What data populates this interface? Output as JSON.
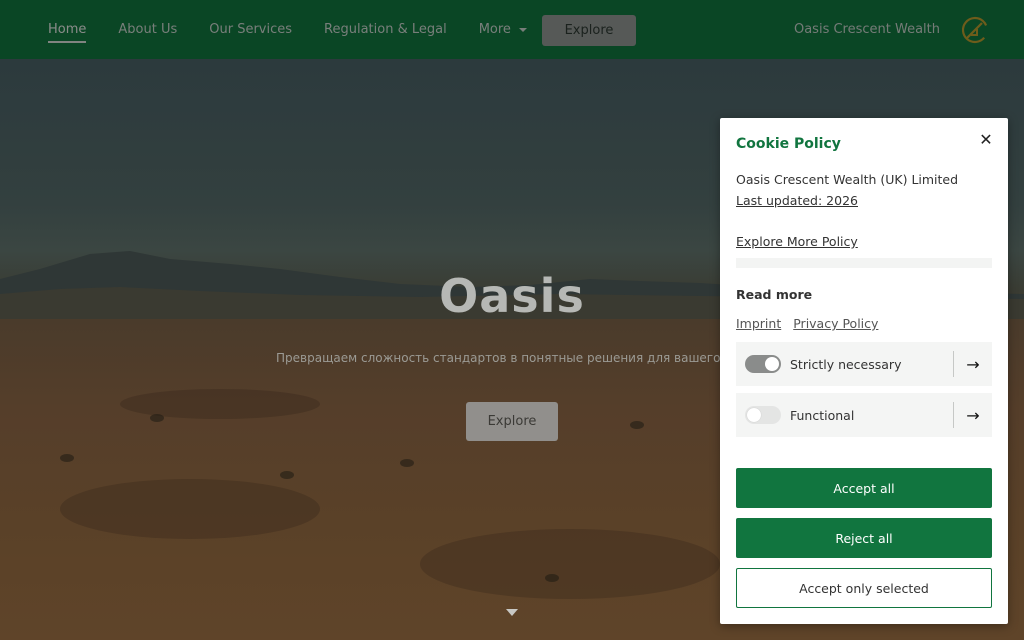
{
  "nav": {
    "items": [
      {
        "label": "Home",
        "active": true
      },
      {
        "label": "About Us"
      },
      {
        "label": "Our Services"
      },
      {
        "label": "Regulation & Legal"
      },
      {
        "label": "More",
        "has_dropdown": true
      }
    ],
    "explore_label": "Explore",
    "brand_name": "Oasis Crescent Wealth",
    "brand_icon": "crescent-logo-icon"
  },
  "hero": {
    "title": "Oasis",
    "subtitle": "Превращаем сложность стандартов в понятные решения для вашего биз",
    "explore_label": "Explore",
    "scroll_icon": "triangle-down-icon"
  },
  "cookie": {
    "title": "Cookie Policy",
    "close_icon": "close-icon",
    "company": "Oasis Crescent Wealth (UK) Limited",
    "last_updated": "Last updated: 2026",
    "explore_more": "Explore More Policy",
    "read_more": "Read more",
    "links": [
      "Imprint",
      "Privacy Policy"
    ],
    "preferences": [
      {
        "label": "Strictly necessary",
        "enabled": true
      },
      {
        "label": "Functional",
        "enabled": false
      }
    ],
    "arrow_icon": "arrow-right-icon",
    "accept_all": "Accept all",
    "reject_all": "Reject all",
    "accept_selected": "Accept only selected"
  },
  "colors": {
    "brand_green": "#11753f",
    "logo_gold": "#c9a227"
  }
}
